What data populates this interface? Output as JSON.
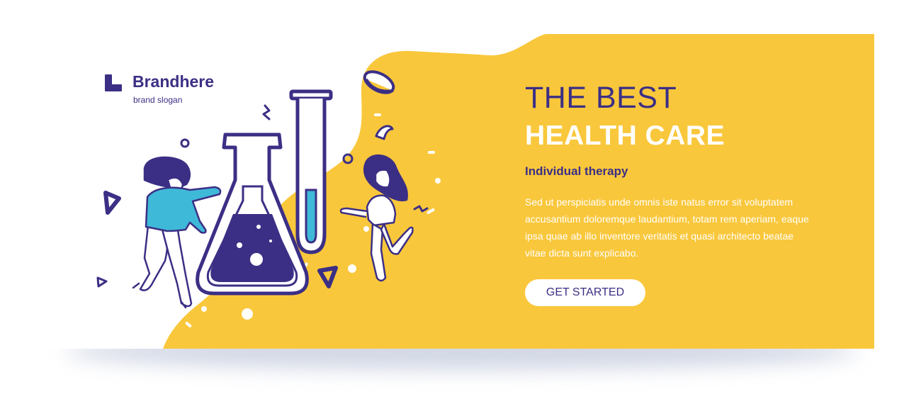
{
  "brand": {
    "name": "Brandhere",
    "slogan": "brand slogan"
  },
  "hero": {
    "headline_line1": "THE BEST",
    "headline_line2": "HEALTH CARE",
    "subtitle": "Individual therapy",
    "body": "Sed ut perspiciatis unde omnis iste natus error sit voluptatem accusantium doloremque laudantium, totam rem aperiam, eaque ipsa quae ab illo inventore veritatis et quasi architecto beatae vitae dicta sunt explicabo.",
    "cta_label": "GET STARTED"
  },
  "colors": {
    "accent_yellow": "#f9c73b",
    "brand_purple": "#3b2f85",
    "accent_cyan": "#3fb9d8",
    "background": "#ffffff"
  },
  "icons": [
    "brand-logo-icon",
    "flask-icon",
    "test-tube-icon",
    "pill-icon",
    "woman-figure",
    "girl-figure"
  ]
}
